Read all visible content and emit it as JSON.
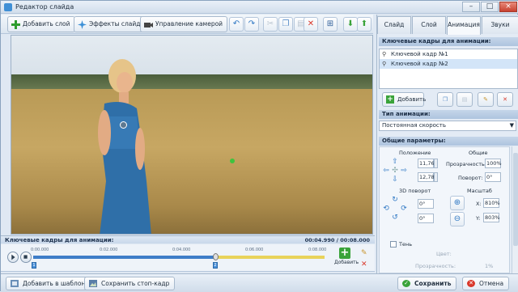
{
  "window": {
    "title": "Редактор слайда",
    "minimize": "–",
    "maximize": "□",
    "close": "×"
  },
  "toolbar": {
    "add_layer": "Добавить слой",
    "slide_effects": "Эффекты слайда",
    "camera_control": "Управление камерой"
  },
  "tabs": [
    "Слайд",
    "Слой",
    "Анимация",
    "Звуки"
  ],
  "active_tab": "Анимация",
  "keyframes_panel": {
    "title": "Ключевые кадры для анимации:",
    "items": [
      "Ключевой кадр №1",
      "Ключевой кадр №2"
    ],
    "selected_index": 1,
    "add_label": "Добавить"
  },
  "animation_type": {
    "title": "Тип анимации:",
    "value": "Постоянная скорость"
  },
  "params": {
    "title": "Общие параметры:",
    "position_label": "Положение",
    "general_label": "Общие",
    "pos_x": "11,76",
    "pos_y": "12,78",
    "transparency_label": "Прозрачность:",
    "transparency_value": "100%",
    "rotation_label": "Поворот:",
    "rotation_value": "0°",
    "rotate3d_label": "3D поворот",
    "rot3d_a": "0°",
    "rot3d_b": "0°",
    "scale_label": "Масштаб",
    "scale_x_label": "X:",
    "scale_x": "810%",
    "scale_y_label": "Y:",
    "scale_y": "803%",
    "shadow_label": "Тень",
    "color_label": "Цвет:",
    "opacity_label": "Прозрачность:",
    "opacity_value": "1%"
  },
  "timeline": {
    "title": "Ключевые кадры для анимации:",
    "time": "00:04.990 / 00:08.000",
    "ticks": [
      "0:00.000",
      "0:02.000",
      "0:04.000",
      "0:06.000",
      "0:08.000"
    ],
    "keyframe_labels": [
      "1",
      "2"
    ],
    "add_label": "Добавить"
  },
  "bottom": {
    "add_to_templates": "Добавить в шаблоны",
    "save_frame": "Сохранить стоп-кадр",
    "save": "Сохранить",
    "cancel": "Отмена"
  },
  "colors": {
    "accent": "#3e7dc8",
    "selected": "#d3e5f8",
    "add_green": "#3aa33a",
    "delete_red": "#d9382b"
  }
}
